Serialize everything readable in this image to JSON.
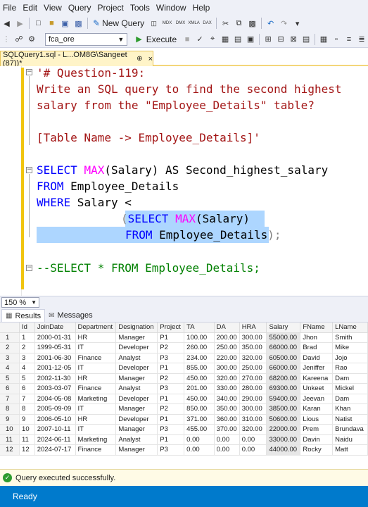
{
  "menu": [
    "File",
    "Edit",
    "View",
    "Query",
    "Project",
    "Tools",
    "Window",
    "Help"
  ],
  "toolbar": {
    "new_query_label": "New Query",
    "database": "fca_ore",
    "execute_label": "Execute",
    "icon_labels": [
      "MDX",
      "DMX",
      "XMLA",
      "DAX"
    ]
  },
  "tab": {
    "title": "SQLQuery1.sql - L...OM8G\\Sangeet (87))*",
    "pin": "⊕",
    "close": "×"
  },
  "editor": {
    "comment_lines": [
      "'# Question-119:",
      "Write an SQL query to find the second highest",
      "salary from the \"Employee_Details\" table?",
      "[Table Name -> Employee_Details]'"
    ],
    "select_kw": "SELECT",
    "max_fn": "MAX",
    "select_rest": "(Salary) AS Second_highest_salary",
    "from_kw": "FROM",
    "from_table": " Employee_Details",
    "where_kw": "WHERE",
    "where_rest": " Salary <",
    "sub_open": "(",
    "sub_select_kw": "SELECT",
    "sub_max_fn": "MAX",
    "sub_select_rest": "(Salary)",
    "sub_from_kw": "FROM",
    "sub_from_table": " Employee_Details",
    "sub_close": ");",
    "commented_line": "--SELECT * FROM Employee_Details;"
  },
  "zoom": "150 %",
  "results_tabs": [
    "Results",
    "Messages"
  ],
  "grid": {
    "columns": [
      "Id",
      "JoinDate",
      "Department",
      "Designation",
      "Project",
      "TA",
      "DA",
      "HRA",
      "Salary",
      "FName",
      "LName"
    ],
    "rows": [
      [
        "1",
        "1",
        "2000-01-31",
        "HR",
        "Manager",
        "P1",
        "100.00",
        "200.00",
        "300.00",
        "55000.00",
        "Jhon",
        "Smith"
      ],
      [
        "2",
        "2",
        "1999-05-31",
        "IT",
        "Developer",
        "P2",
        "260.00",
        "250.00",
        "350.00",
        "66000.00",
        "Brad",
        "Mike"
      ],
      [
        "3",
        "3",
        "2001-06-30",
        "Finance",
        "Analyst",
        "P3",
        "234.00",
        "220.00",
        "320.00",
        "60500.00",
        "David",
        "Jojo"
      ],
      [
        "4",
        "4",
        "2001-12-05",
        "IT",
        "Developer",
        "P1",
        "855.00",
        "300.00",
        "250.00",
        "66000.00",
        "Jeniffer",
        "Rao"
      ],
      [
        "5",
        "5",
        "2002-11-30",
        "HR",
        "Manager",
        "P2",
        "450.00",
        "320.00",
        "270.00",
        "68200.00",
        "Kareena",
        "Dam"
      ],
      [
        "6",
        "6",
        "2003-03-07",
        "Finance",
        "Analyst",
        "P3",
        "201.00",
        "330.00",
        "280.00",
        "69300.00",
        "Unkeet",
        "Mickel"
      ],
      [
        "7",
        "7",
        "2004-05-08",
        "Marketing",
        "Developer",
        "P1",
        "450.00",
        "340.00",
        "290.00",
        "59400.00",
        "Jeevan",
        "Dam"
      ],
      [
        "8",
        "8",
        "2005-09-09",
        "IT",
        "Manager",
        "P2",
        "850.00",
        "350.00",
        "300.00",
        "38500.00",
        "Karan",
        "Khan"
      ],
      [
        "9",
        "9",
        "2006-05-10",
        "HR",
        "Developer",
        "P1",
        "371.00",
        "360.00",
        "310.00",
        "50600.00",
        "Lious",
        "Natist"
      ],
      [
        "10",
        "10",
        "2007-10-11",
        "IT",
        "Manager",
        "P3",
        "455.00",
        "370.00",
        "320.00",
        "22000.00",
        "Prem",
        "Brundava"
      ],
      [
        "11",
        "11",
        "2024-06-11",
        "Marketing",
        "Analyst",
        "P1",
        "0.00",
        "0.00",
        "0.00",
        "33000.00",
        "Davin",
        "Naidu"
      ],
      [
        "12",
        "12",
        "2024-07-17",
        "Finance",
        "Manager",
        "P3",
        "0.00",
        "0.00",
        "0.00",
        "44000.00",
        "Rocky",
        "Matt"
      ]
    ]
  },
  "query_status": "Query executed successfully.",
  "status_bar": "Ready"
}
